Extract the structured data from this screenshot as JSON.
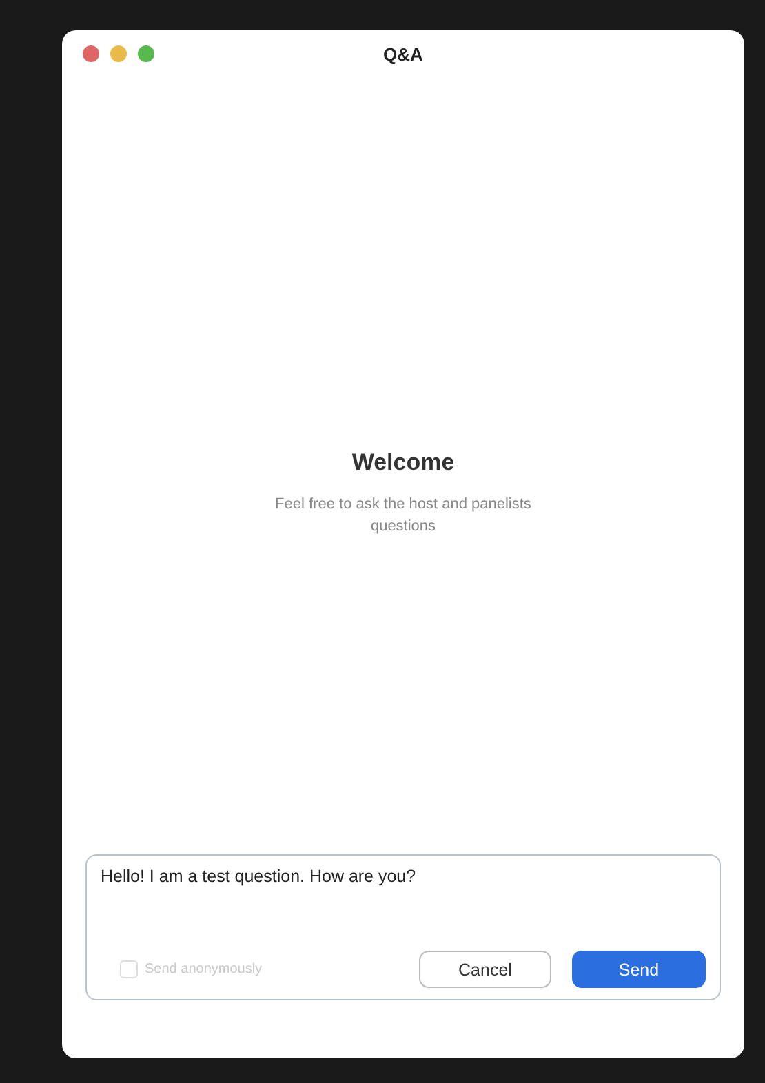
{
  "window": {
    "title": "Q&A"
  },
  "welcome": {
    "heading": "Welcome",
    "message": "Feel free to ask the host and panelists questions"
  },
  "composer": {
    "value": "Hello! I am a test question. How are you?",
    "anonymous": {
      "label": "Send anonymously",
      "checked": false
    },
    "buttons": [
      {
        "label": "Cancel",
        "kind": "secondary"
      },
      {
        "label": "Send",
        "kind": "primary"
      }
    ]
  }
}
